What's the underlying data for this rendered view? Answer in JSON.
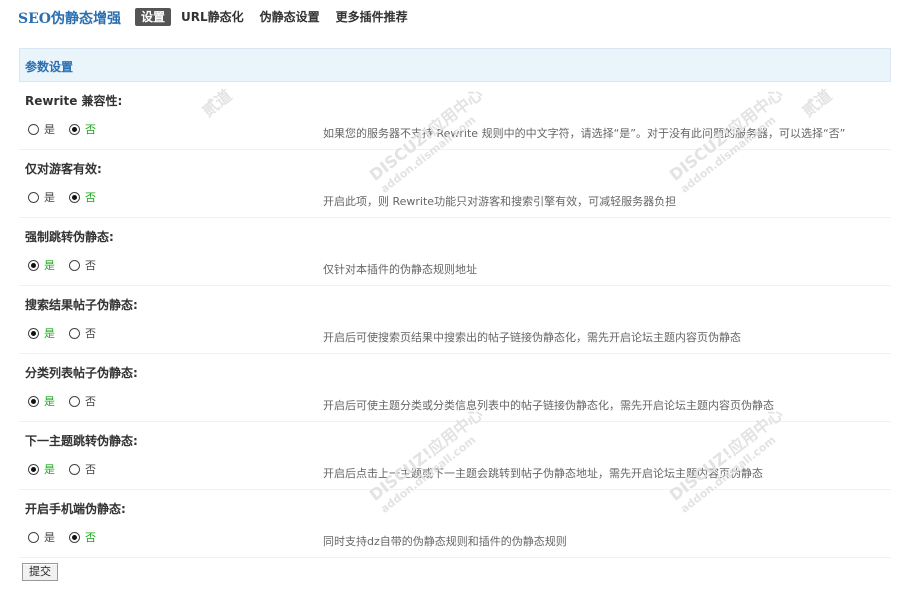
{
  "app": {
    "title": "SEO伪静态增强"
  },
  "tabs": [
    {
      "label": "设置",
      "active": true
    },
    {
      "label": "URL静态化",
      "active": false
    },
    {
      "label": "伪静态设置",
      "active": false
    },
    {
      "label": "更多插件推荐",
      "active": false
    }
  ],
  "panel": {
    "title": "参数设置"
  },
  "options": {
    "yes": "是",
    "no": "否"
  },
  "rows": [
    {
      "label": "Rewrite 兼容性:",
      "selected": "no",
      "desc": "如果您的服务器不支持 Rewrite 规则中的中文字符，请选择“是”。对于没有此问题的服务器，可以选择“否”"
    },
    {
      "label": "仅对游客有效:",
      "selected": "no",
      "desc": "开启此项，则 Rewrite功能只对游客和搜索引擎有效，可减轻服务器负担"
    },
    {
      "label": "强制跳转伪静态:",
      "selected": "yes",
      "desc": "仅针对本插件的伪静态规则地址"
    },
    {
      "label": "搜索结果帖子伪静态:",
      "selected": "yes",
      "desc": "开启后可使搜索页结果中搜索出的帖子链接伪静态化，需先开启论坛主题内容页伪静态"
    },
    {
      "label": "分类列表帖子伪静态:",
      "selected": "yes",
      "desc": "开启后可使主题分类或分类信息列表中的帖子链接伪静态化，需先开启论坛主题内容页伪静态"
    },
    {
      "label": "下一主题跳转伪静态:",
      "selected": "yes",
      "desc": "开启后点击上一主题或下一主题会跳转到帖子伪静态地址，需先开启论坛主题内容页伪静态"
    },
    {
      "label": "开启手机端伪静态:",
      "selected": "no",
      "desc": "同时支持dz自带的伪静态规则和插件的伪静态规则"
    }
  ],
  "submit": {
    "label": "提交"
  },
  "watermark": {
    "brand": "DISCUZ!应用中心",
    "domain": "addon.dismall.com",
    "mark": "贰道"
  },
  "colors": {
    "title": "#2a6fb0",
    "checked_text": "#1aa51a",
    "header_bg": "#eaf4fb"
  }
}
